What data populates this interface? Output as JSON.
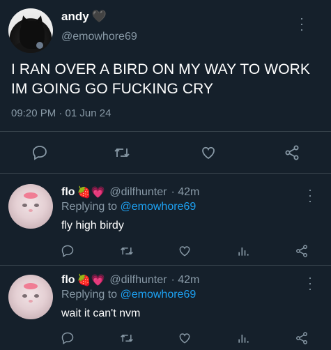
{
  "main_tweet": {
    "display_name": "andy",
    "name_emoji": "🖤",
    "handle": "@emowhore69",
    "text": "I RAN OVER A BIRD ON MY WAY TO WORK IM GOING GO FUCKING CRY",
    "timestamp": "09:20 PM · 01 Jun 24",
    "actions": [
      "reply-icon",
      "retweet-icon",
      "like-icon",
      "share-icon"
    ]
  },
  "replies": [
    {
      "display_name": "flo",
      "name_emoji": "🍓💗",
      "handle": "@dilfhunter",
      "time": "· 42m",
      "replying_prefix": "Replying to ",
      "replying_to": "@emowhore69",
      "text": "fly high birdy",
      "actions": [
        "reply-icon",
        "retweet-icon",
        "like-icon",
        "stats-icon",
        "share-icon"
      ]
    },
    {
      "display_name": "flo",
      "name_emoji": "🍓💗",
      "handle": "@dilfhunter",
      "time": "· 42m",
      "replying_prefix": "Replying to ",
      "replying_to": "@emowhore69",
      "text": "wait it can't nvm",
      "actions": [
        "reply-icon",
        "retweet-icon",
        "like-icon",
        "stats-icon",
        "share-icon"
      ]
    }
  ],
  "colors": {
    "background": "#15202b",
    "secondary_text": "#8899a6",
    "accent": "#1da1f2",
    "divider": "#38444d"
  }
}
